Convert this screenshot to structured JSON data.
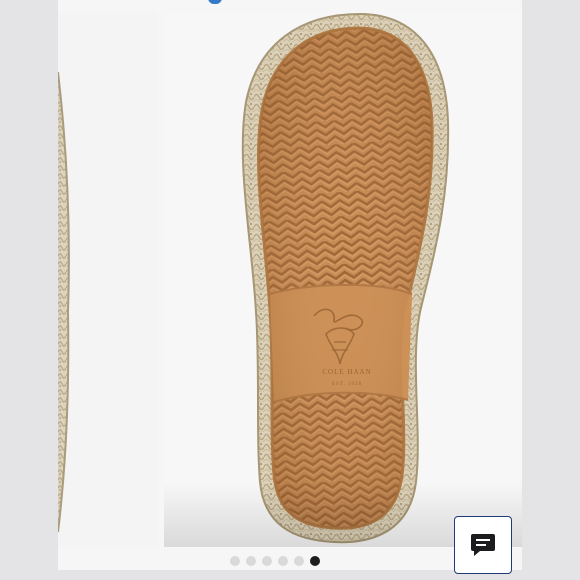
{
  "gallery": {
    "slide_count": 6,
    "active_slide_index": 5,
    "current_image": {
      "imprint_brand": "COLE HAAN",
      "imprint_tagline": "EST. 1928"
    }
  },
  "chat_button": {
    "icon": "chat-icon"
  },
  "colors": {
    "page_background": "#e4e4e6",
    "sole_tan": "#c58a55",
    "jute_braid": "#d8cdb4",
    "chat_border": "#1e3b7a",
    "active_dot": "#1d1d1f",
    "inactive_dot": "#d9d9dc",
    "accent_blue": "#3478c8"
  }
}
